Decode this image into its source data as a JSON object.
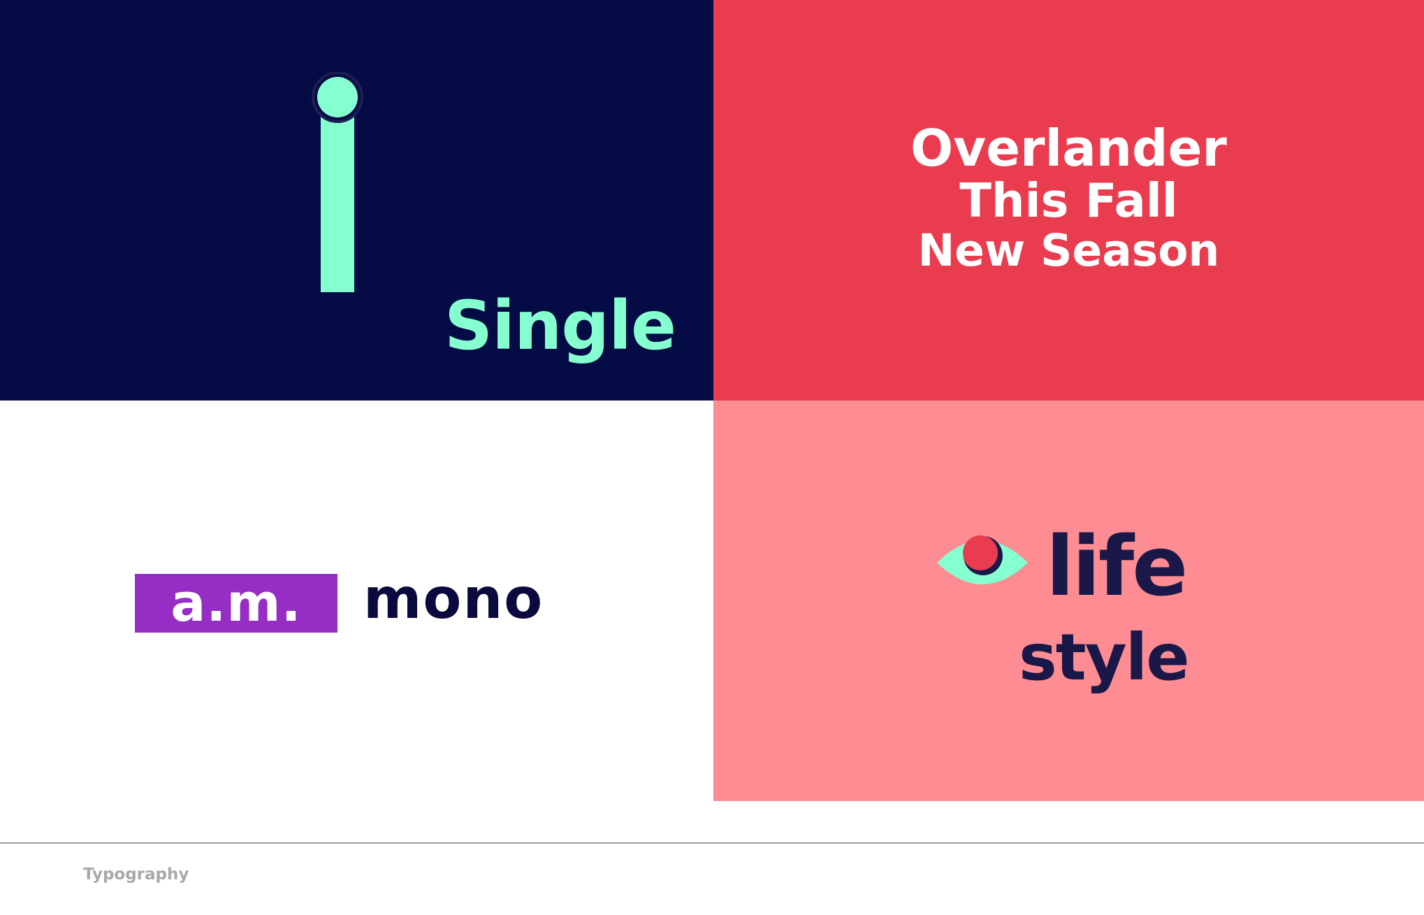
{
  "panels": {
    "single": {
      "word": "Single",
      "background": "#050b45",
      "accent": "#86ffd0",
      "glyph": "letter-i-icon"
    },
    "overlander": {
      "lines": [
        "Overlander",
        "This Fall",
        "New Season"
      ],
      "background": "#e93c4f",
      "text_color": "#ffffff"
    },
    "mono": {
      "badge": "a.m.",
      "word": "mono",
      "badge_color": "#962ec5",
      "text_color": "#0a0a3e"
    },
    "lifestyle": {
      "line1": "life",
      "line2": "style",
      "background": "#fd8c93",
      "text_color": "#1a1848",
      "glyph": "eye-icon"
    }
  },
  "footer": {
    "caption": "Typography"
  }
}
